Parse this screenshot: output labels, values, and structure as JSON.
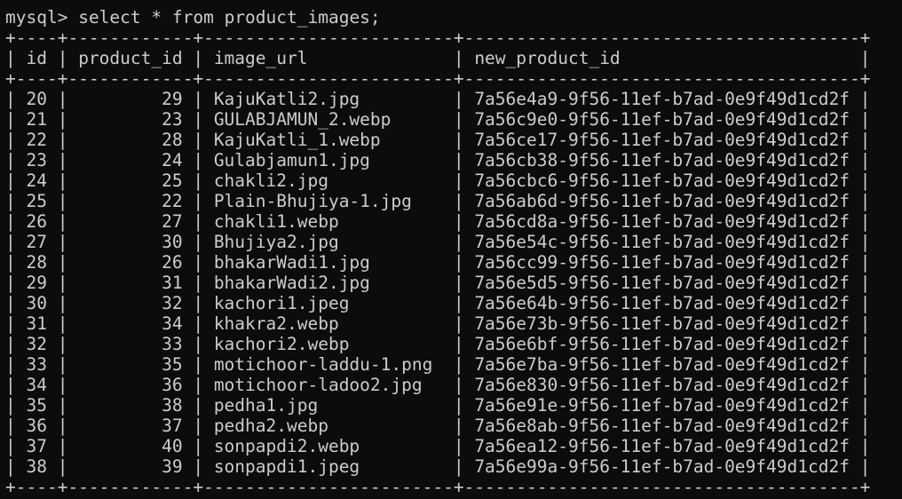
{
  "prompt": "mysql>",
  "command": "select * from product_images;",
  "border": "+----+------------+------------------------+--------------------------------------+",
  "columns": {
    "id": "id",
    "product_id": "product_id",
    "image_url": "image_url",
    "new_product_id": "new_product_id"
  },
  "rows": [
    {
      "id": "20",
      "product_id": "29",
      "image_url": "KajuKatli2.jpg",
      "new_product_id": "7a56e4a9-9f56-11ef-b7ad-0e9f49d1cd2f"
    },
    {
      "id": "21",
      "product_id": "23",
      "image_url": "GULABJAMUN_2.webp",
      "new_product_id": "7a56c9e0-9f56-11ef-b7ad-0e9f49d1cd2f"
    },
    {
      "id": "22",
      "product_id": "28",
      "image_url": "KajuKatli_1.webp",
      "new_product_id": "7a56ce17-9f56-11ef-b7ad-0e9f49d1cd2f"
    },
    {
      "id": "23",
      "product_id": "24",
      "image_url": "Gulabjamun1.jpg",
      "new_product_id": "7a56cb38-9f56-11ef-b7ad-0e9f49d1cd2f"
    },
    {
      "id": "24",
      "product_id": "25",
      "image_url": "chakli2.jpg",
      "new_product_id": "7a56cbc6-9f56-11ef-b7ad-0e9f49d1cd2f"
    },
    {
      "id": "25",
      "product_id": "22",
      "image_url": "Plain-Bhujiya-1.jpg",
      "new_product_id": "7a56ab6d-9f56-11ef-b7ad-0e9f49d1cd2f"
    },
    {
      "id": "26",
      "product_id": "27",
      "image_url": "chakli1.webp",
      "new_product_id": "7a56cd8a-9f56-11ef-b7ad-0e9f49d1cd2f"
    },
    {
      "id": "27",
      "product_id": "30",
      "image_url": "Bhujiya2.jpg",
      "new_product_id": "7a56e54c-9f56-11ef-b7ad-0e9f49d1cd2f"
    },
    {
      "id": "28",
      "product_id": "26",
      "image_url": "bhakarWadi1.jpg",
      "new_product_id": "7a56cc99-9f56-11ef-b7ad-0e9f49d1cd2f"
    },
    {
      "id": "29",
      "product_id": "31",
      "image_url": "bhakarWadi2.jpg",
      "new_product_id": "7a56e5d5-9f56-11ef-b7ad-0e9f49d1cd2f"
    },
    {
      "id": "30",
      "product_id": "32",
      "image_url": "kachori1.jpeg",
      "new_product_id": "7a56e64b-9f56-11ef-b7ad-0e9f49d1cd2f"
    },
    {
      "id": "31",
      "product_id": "34",
      "image_url": "khakra2.webp",
      "new_product_id": "7a56e73b-9f56-11ef-b7ad-0e9f49d1cd2f"
    },
    {
      "id": "32",
      "product_id": "33",
      "image_url": "kachori2.webp",
      "new_product_id": "7a56e6bf-9f56-11ef-b7ad-0e9f49d1cd2f"
    },
    {
      "id": "33",
      "product_id": "35",
      "image_url": "motichoor-laddu-1.png",
      "new_product_id": "7a56e7ba-9f56-11ef-b7ad-0e9f49d1cd2f"
    },
    {
      "id": "34",
      "product_id": "36",
      "image_url": "motichoor-ladoo2.jpg",
      "new_product_id": "7a56e830-9f56-11ef-b7ad-0e9f49d1cd2f"
    },
    {
      "id": "35",
      "product_id": "38",
      "image_url": "pedha1.jpg",
      "new_product_id": "7a56e91e-9f56-11ef-b7ad-0e9f49d1cd2f"
    },
    {
      "id": "36",
      "product_id": "37",
      "image_url": "pedha2.webp",
      "new_product_id": "7a56e8ab-9f56-11ef-b7ad-0e9f49d1cd2f"
    },
    {
      "id": "37",
      "product_id": "40",
      "image_url": "sonpapdi2.webp",
      "new_product_id": "7a56ea12-9f56-11ef-b7ad-0e9f49d1cd2f"
    },
    {
      "id": "38",
      "product_id": "39",
      "image_url": "sonpapdi1.jpeg",
      "new_product_id": "7a56e99a-9f56-11ef-b7ad-0e9f49d1cd2f"
    }
  ]
}
